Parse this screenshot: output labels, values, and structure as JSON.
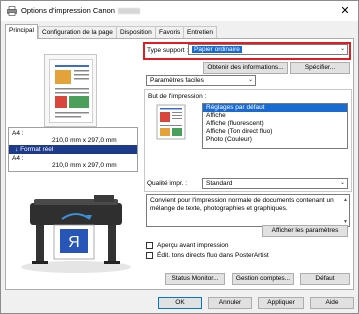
{
  "window": {
    "title": "Options d'impression Canon",
    "close_icon": "close-icon"
  },
  "tabs": [
    "Principal",
    "Configuration de la page",
    "Disposition",
    "Favoris",
    "Entretien"
  ],
  "preview": {
    "size1_label": "A4 :",
    "size1_value": "210,0 mm x 297,0 mm",
    "real_format": "Format réel",
    "size2_label": "A4 :",
    "size2_value": "210,0 mm x 297,0 mm"
  },
  "media": {
    "label": "Type support :",
    "value": "Papier ordinaire",
    "info_button": "Obtenir des informations...",
    "specify_button": "Spécifier..."
  },
  "settings_combo": "Paramètres faciles",
  "purpose": {
    "label": "But de l'impression :",
    "items": [
      "Réglages par défaut",
      "Affiche",
      "Affiche (fluorescent)",
      "Affiche (Ton direct fluo)",
      "Photo (Couleur)"
    ],
    "selected_index": 0
  },
  "quality": {
    "label": "Qualité impr. :",
    "value": "Standard"
  },
  "description": "Convient pour l'impression normale de documents contenant un mélange de texte, photographies et graphiques.",
  "show_settings_button": "Afficher les paramètres",
  "checkboxes": {
    "preview": "Aperçu avant impression",
    "posterartist": "Édit. tons directs fluo dans PosterArtist"
  },
  "lower_buttons": {
    "status": "Status Monitor...",
    "accounts": "Gestion comptes...",
    "default": "Défaut"
  },
  "dialog_buttons": {
    "ok": "OK",
    "cancel": "Annuler",
    "apply": "Appliquer",
    "help": "Aide"
  },
  "colors": {
    "selection": "#1a6bd1",
    "highlight_border": "#e31b23",
    "real_format_bg": "#1e3a8a"
  }
}
